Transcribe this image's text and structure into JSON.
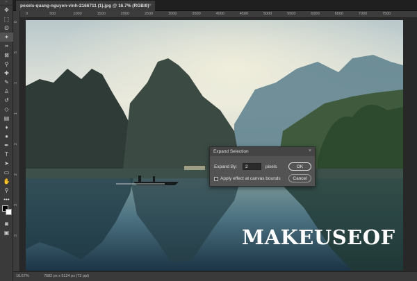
{
  "document": {
    "tab_title": "pexels-quang-nguyen-vinh-2166711 (1).jpg @ 16.7% (RGB/8)",
    "close_glyph": "×"
  },
  "toolbar": {
    "tools": [
      {
        "name": "move-tool-icon",
        "glyph": "✥"
      },
      {
        "name": "marquee-tool-icon",
        "glyph": "⬚"
      },
      {
        "name": "lasso-tool-icon",
        "glyph": "ʘ"
      },
      {
        "name": "magic-wand-tool-icon",
        "glyph": "✦",
        "active": true
      },
      {
        "name": "crop-tool-icon",
        "glyph": "⌗"
      },
      {
        "name": "frame-tool-icon",
        "glyph": "⊠"
      },
      {
        "name": "eyedropper-tool-icon",
        "glyph": "⚲"
      },
      {
        "name": "healing-brush-tool-icon",
        "glyph": "✚"
      },
      {
        "name": "brush-tool-icon",
        "glyph": "✎"
      },
      {
        "name": "clone-stamp-tool-icon",
        "glyph": "♙"
      },
      {
        "name": "history-brush-tool-icon",
        "glyph": "↺"
      },
      {
        "name": "eraser-tool-icon",
        "glyph": "◇"
      },
      {
        "name": "gradient-tool-icon",
        "glyph": "▤"
      },
      {
        "name": "blur-tool-icon",
        "glyph": "♦"
      },
      {
        "name": "dodge-tool-icon",
        "glyph": "●"
      },
      {
        "name": "pen-tool-icon",
        "glyph": "✒"
      },
      {
        "name": "type-tool-icon",
        "glyph": "T"
      },
      {
        "name": "path-selection-tool-icon",
        "glyph": "➤"
      },
      {
        "name": "rectangle-tool-icon",
        "glyph": "▭"
      },
      {
        "name": "hand-tool-icon",
        "glyph": "✋"
      },
      {
        "name": "zoom-tool-icon",
        "glyph": "⚲"
      },
      {
        "name": "more-tools-icon",
        "glyph": "•••"
      }
    ],
    "bottom_tools": [
      {
        "name": "quick-mask-icon",
        "glyph": "◙"
      },
      {
        "name": "screen-mode-icon",
        "glyph": "▣"
      }
    ]
  },
  "ruler": {
    "top_labels": [
      "0",
      "500",
      "1000",
      "1500",
      "2000",
      "2500",
      "3000",
      "3500",
      "4000",
      "4500",
      "5000",
      "5500",
      "6000",
      "6500",
      "7000",
      "7500"
    ],
    "left_labels": [
      "0",
      "5",
      "1",
      "1",
      "2",
      "2",
      "3",
      "3"
    ]
  },
  "watermark": "MAKEUSEOF",
  "dialog": {
    "title": "Expand Selection",
    "close_glyph": "×",
    "expand_label": "Expand By:",
    "expand_value": "2",
    "unit": "pixels",
    "checkbox_label": "Apply effect at canvas bounds",
    "checkbox_checked": false,
    "ok_label": "OK",
    "cancel_label": "Cancel"
  },
  "status": {
    "zoom": "16.67%",
    "doc_info": "7682 px x 5124 px (72 ppi)",
    "arrow_glyph": "›"
  }
}
